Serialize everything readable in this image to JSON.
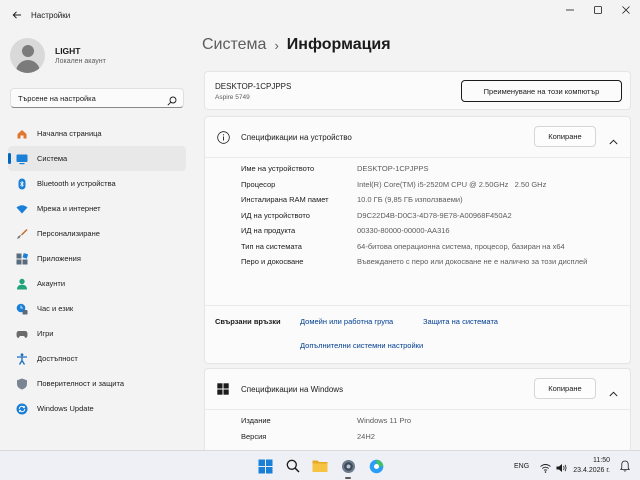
{
  "window": {
    "title": "Настройки"
  },
  "profile": {
    "name": "LIGHT",
    "account_type": "Локален акаунт"
  },
  "search": {
    "placeholder": "Търсене на настройка"
  },
  "sidebar": {
    "items": [
      {
        "label": "Начална страница",
        "icon": "home-icon"
      },
      {
        "label": "Система",
        "icon": "system-icon",
        "active": true
      },
      {
        "label": "Bluetooth и устройства",
        "icon": "bluetooth-icon"
      },
      {
        "label": "Мрежа и интернет",
        "icon": "wifi-icon"
      },
      {
        "label": "Персонализиране",
        "icon": "brush-icon"
      },
      {
        "label": "Приложения",
        "icon": "apps-icon"
      },
      {
        "label": "Акаунти",
        "icon": "accounts-icon"
      },
      {
        "label": "Час и език",
        "icon": "time-language-icon"
      },
      {
        "label": "Игри",
        "icon": "gaming-icon"
      },
      {
        "label": "Достъпност",
        "icon": "accessibility-icon"
      },
      {
        "label": "Поверителност и защита",
        "icon": "shield-icon"
      },
      {
        "label": "Windows Update",
        "icon": "update-icon"
      }
    ]
  },
  "breadcrumb": {
    "parent": "Система",
    "separator": "›",
    "current": "Информация"
  },
  "device": {
    "name": "DESKTOP-1CPJPPS",
    "model": "Aspire 5749",
    "rename_button": "Преименуване на този компютър"
  },
  "device_specs": {
    "title": "Спецификации на устройство",
    "copy_button": "Копиране",
    "rows": [
      {
        "key": "Име на устройството",
        "value": "DESKTOP-1CPJPPS"
      },
      {
        "key": "Процесор",
        "value": "Intel(R) Core(TM) i5-2520M CPU @ 2.50GHz   2.50 GHz"
      },
      {
        "key": "Инсталирана RAM памет",
        "value": "10.0 ГБ (9,85 ГБ използваеми)"
      },
      {
        "key": "ИД на устройството",
        "value": "D9C22D4B-D0C3-4D78-9E78-A00968F450A2"
      },
      {
        "key": "ИД на продукта",
        "value": "00330-80000-00000-AA316"
      },
      {
        "key": "Тип на системата",
        "value": "64-битова операционна система, процесор, базиран на x64"
      },
      {
        "key": "Перо и докосване",
        "value": "Въвеждането с перо или докосване не е налично за този дисплей"
      }
    ]
  },
  "related": {
    "label": "Свързани връзки",
    "links": [
      "Домейн или работна група",
      "Защита на системата",
      "Допълнителни системни настройки"
    ]
  },
  "windows_specs": {
    "title": "Спецификации на Windows",
    "copy_button": "Копиране",
    "rows": [
      {
        "key": "Издание",
        "value": "Windows 11 Pro"
      },
      {
        "key": "Версия",
        "value": "24H2"
      }
    ]
  },
  "taskbar": {
    "language": "ENG",
    "time": "11:50",
    "date": "23.4.2026 г."
  },
  "colors": {
    "accent": "#0067c0",
    "link": "#003e92"
  }
}
